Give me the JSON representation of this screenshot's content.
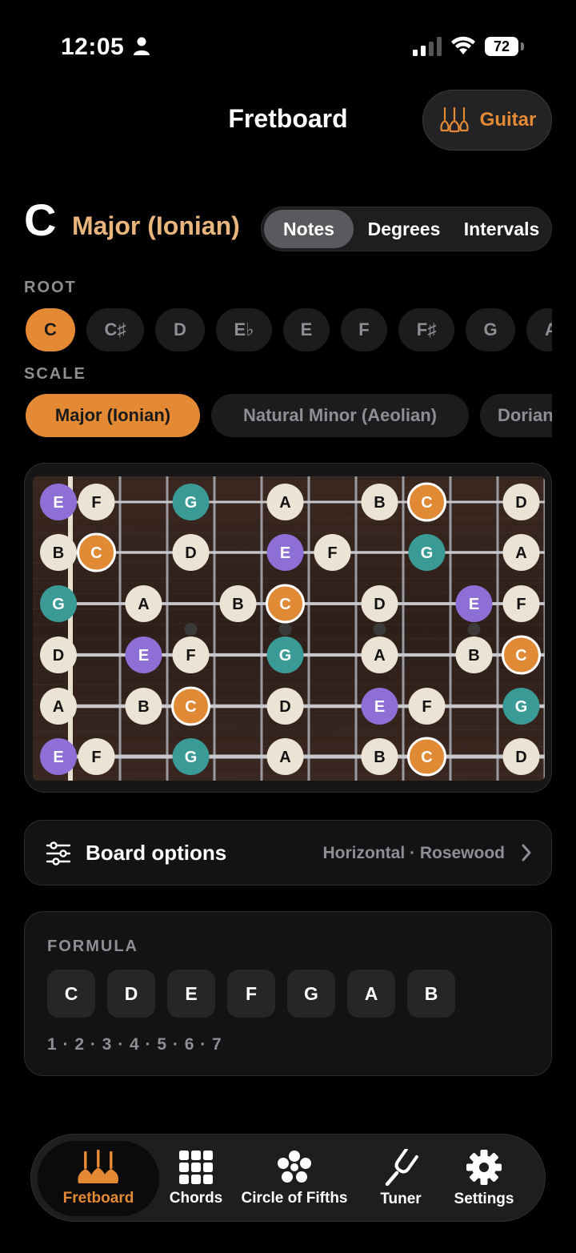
{
  "status_bar": {
    "time": "12:05",
    "battery": "72"
  },
  "header": {
    "title": "Fretboard",
    "instrument_label": "Guitar"
  },
  "key": {
    "root": "C",
    "scale_name": "Major (Ionian)",
    "view_modes": [
      "Notes",
      "Degrees",
      "Intervals"
    ],
    "active_view": "Notes"
  },
  "root_section": {
    "label": "ROOT",
    "options": [
      "C",
      "C♯",
      "D",
      "E♭",
      "E",
      "F",
      "F♯",
      "G",
      "A"
    ],
    "selected": "C"
  },
  "scale_section": {
    "label": "SCALE",
    "options": [
      "Major (Ionian)",
      "Natural Minor (Aeolian)",
      "Dorian"
    ],
    "selected": "Major (Ionian)"
  },
  "fretboard": {
    "strings": [
      [
        {
          "f": 0,
          "n": "E"
        },
        {
          "f": 1,
          "n": "F"
        },
        {
          "f": 3,
          "n": "G"
        },
        {
          "f": 5,
          "n": "A"
        },
        {
          "f": 7,
          "n": "B"
        },
        {
          "f": 8,
          "n": "C"
        },
        {
          "f": 10,
          "n": "D"
        }
      ],
      [
        {
          "f": 0,
          "n": "B"
        },
        {
          "f": 1,
          "n": "C"
        },
        {
          "f": 3,
          "n": "D"
        },
        {
          "f": 5,
          "n": "E"
        },
        {
          "f": 6,
          "n": "F"
        },
        {
          "f": 8,
          "n": "G"
        },
        {
          "f": 10,
          "n": "A"
        }
      ],
      [
        {
          "f": 0,
          "n": "G"
        },
        {
          "f": 2,
          "n": "A"
        },
        {
          "f": 4,
          "n": "B"
        },
        {
          "f": 5,
          "n": "C"
        },
        {
          "f": 7,
          "n": "D"
        },
        {
          "f": 9,
          "n": "E"
        },
        {
          "f": 10,
          "n": "F"
        }
      ],
      [
        {
          "f": 0,
          "n": "D"
        },
        {
          "f": 2,
          "n": "E"
        },
        {
          "f": 3,
          "n": "F"
        },
        {
          "f": 5,
          "n": "G"
        },
        {
          "f": 7,
          "n": "A"
        },
        {
          "f": 9,
          "n": "B"
        },
        {
          "f": 10,
          "n": "C"
        }
      ],
      [
        {
          "f": 0,
          "n": "A"
        },
        {
          "f": 2,
          "n": "B"
        },
        {
          "f": 3,
          "n": "C"
        },
        {
          "f": 5,
          "n": "D"
        },
        {
          "f": 7,
          "n": "E"
        },
        {
          "f": 8,
          "n": "F"
        },
        {
          "f": 10,
          "n": "G"
        }
      ],
      [
        {
          "f": 0,
          "n": "E"
        },
        {
          "f": 1,
          "n": "F"
        },
        {
          "f": 3,
          "n": "G"
        },
        {
          "f": 5,
          "n": "A"
        },
        {
          "f": 7,
          "n": "B"
        },
        {
          "f": 8,
          "n": "C"
        },
        {
          "f": 10,
          "n": "D"
        }
      ]
    ],
    "inlay_frets": [
      3,
      5,
      7,
      9
    ],
    "note_colors": {
      "C": "#e08a35",
      "E": "#8e6fd6",
      "G": "#3a9a96",
      "default": "#ebe3d3"
    }
  },
  "board_options": {
    "label": "Board options",
    "value": "Horizontal · Rosewood"
  },
  "formula": {
    "title": "FORMULA",
    "notes": [
      "C",
      "D",
      "E",
      "F",
      "G",
      "A",
      "B"
    ],
    "degrees": "1 · 2 · 3 · 4 · 5 · 6 · 7"
  },
  "tabs": [
    {
      "label": "Fretboard",
      "icon": "guitars-icon"
    },
    {
      "label": "Chords",
      "icon": "grid-icon"
    },
    {
      "label": "Circle of Fifths",
      "icon": "flower-icon"
    },
    {
      "label": "Tuner",
      "icon": "tuning-fork-icon"
    },
    {
      "label": "Settings",
      "icon": "gear-icon"
    }
  ],
  "active_tab": "Fretboard",
  "colors": {
    "accent": "#e48a35",
    "scale_name": "#e8b57d"
  }
}
